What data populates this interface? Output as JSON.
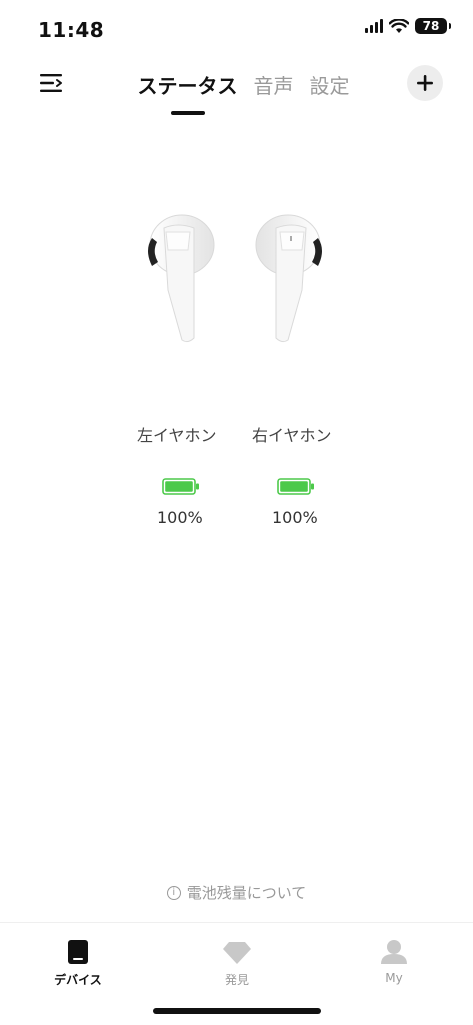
{
  "status_bar": {
    "time": "11:48",
    "battery": "78"
  },
  "tabs": [
    {
      "label": "ステータス",
      "active": true
    },
    {
      "label": "音声",
      "active": false
    },
    {
      "label": "設定",
      "active": false
    }
  ],
  "earbuds": {
    "left": {
      "label": "左イヤホン",
      "battery": "100%",
      "battery_level": 1.0
    },
    "right": {
      "label": "右イヤホン",
      "battery": "100%",
      "battery_level": 1.0
    }
  },
  "info_link": "電池残量について",
  "bottom_nav": [
    {
      "label": "デバイス",
      "icon": "device-icon",
      "active": true
    },
    {
      "label": "発見",
      "icon": "diamond-icon",
      "active": false
    },
    {
      "label": "My",
      "icon": "person-icon",
      "active": false
    }
  ],
  "colors": {
    "battery_green": "#4cc94a",
    "accent": "#111111"
  }
}
